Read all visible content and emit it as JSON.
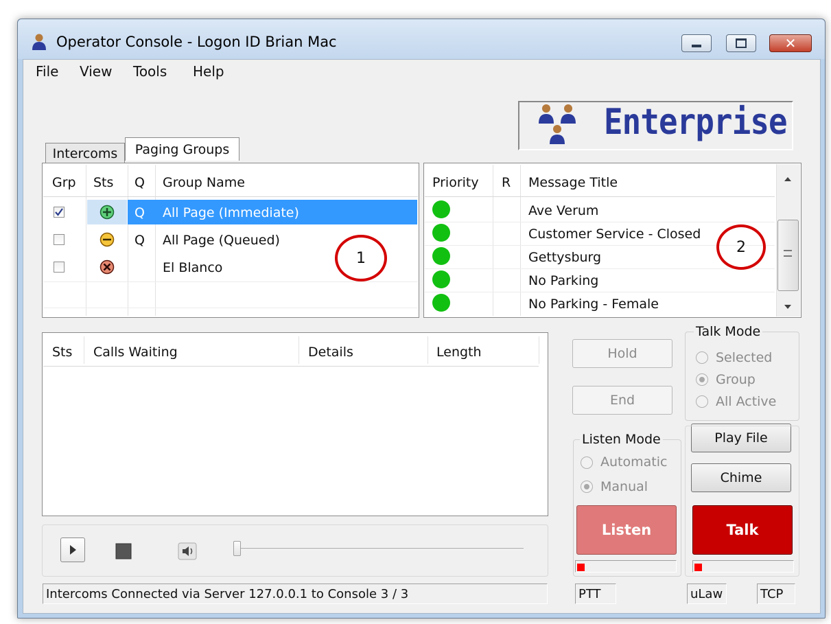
{
  "window": {
    "title": "Operator Console - Logon ID Brian Mac"
  },
  "menu": [
    "File",
    "View",
    "Tools",
    "Help"
  ],
  "logo": {
    "text": "Enterprise"
  },
  "tabs": {
    "items": [
      "Intercoms",
      "Paging Groups"
    ],
    "active": "Paging Groups"
  },
  "groups": {
    "headers": {
      "grp": "Grp",
      "sts": "Sts",
      "q": "Q",
      "name": "Group Name"
    },
    "rows": [
      {
        "checked": true,
        "status": "status-plus-icon",
        "q": "Q",
        "name": "All Page (Immediate)",
        "selected": true
      },
      {
        "checked": false,
        "status": "status-minus-icon",
        "q": "Q",
        "name": "All Page (Queued)",
        "selected": false
      },
      {
        "checked": false,
        "status": "status-x-icon",
        "q": "",
        "name": "El Blanco",
        "selected": false
      }
    ]
  },
  "messages": {
    "headers": {
      "priority": "Priority",
      "r": "R",
      "title": "Message Title"
    },
    "rows": [
      {
        "priority_color": "#12c012",
        "title": "Ave Verum"
      },
      {
        "priority_color": "#12c012",
        "title": "Customer Service - Closed"
      },
      {
        "priority_color": "#12c012",
        "title": "Gettysburg"
      },
      {
        "priority_color": "#12c012",
        "title": "No Parking"
      },
      {
        "priority_color": "#12c012",
        "title": "No Parking - Female"
      }
    ]
  },
  "calls": {
    "headers": {
      "sts": "Sts",
      "calls_waiting": "Calls Waiting",
      "details": "Details",
      "length": "Length"
    }
  },
  "buttons": {
    "hold": "Hold",
    "end": "End",
    "play_file": "Play File",
    "chime": "Chime",
    "listen": "Listen",
    "talk": "Talk"
  },
  "talk_mode": {
    "label": "Talk Mode",
    "options": [
      "Selected",
      "Group",
      "All Active"
    ],
    "selected": "Group"
  },
  "listen_mode": {
    "label": "Listen Mode",
    "options": [
      "Automatic",
      "Manual"
    ],
    "selected": "Manual"
  },
  "callouts": [
    "1",
    "2"
  ],
  "status_bar": {
    "main": "Intercoms Connected via Server 127.0.0.1 to Console 3 / 3",
    "ptt": "PTT",
    "codec": "uLaw",
    "transport": "TCP"
  },
  "colors": {
    "listen_button": "#e07a7a",
    "talk_button": "#c80000",
    "selection": "#3399ff",
    "logo_text": "#2a3a9a",
    "priority_dot": "#12c012"
  }
}
